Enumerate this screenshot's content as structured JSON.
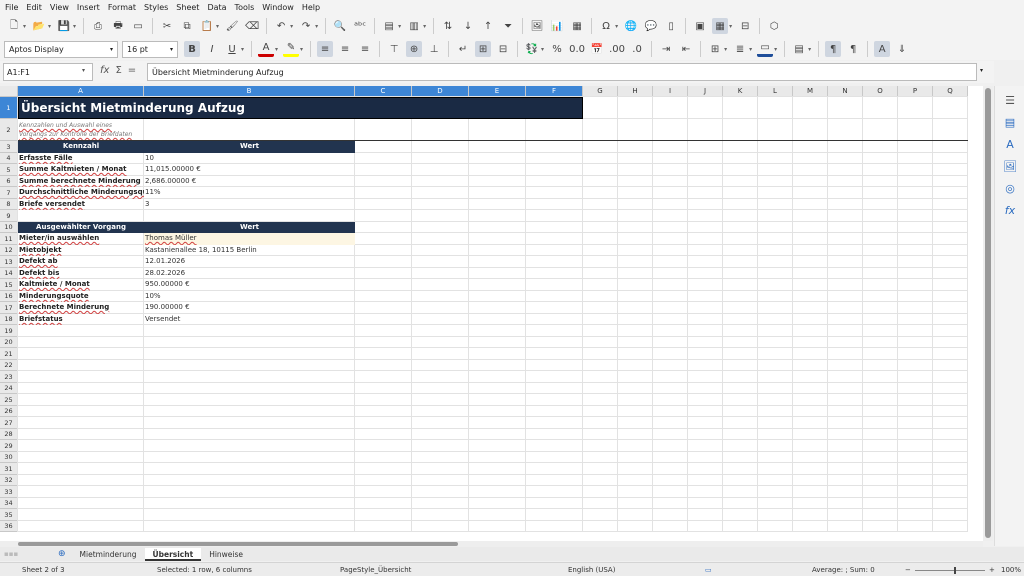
{
  "menu": [
    "File",
    "Edit",
    "View",
    "Insert",
    "Format",
    "Styles",
    "Sheet",
    "Data",
    "Tools",
    "Window",
    "Help"
  ],
  "format": {
    "font_name": "Aptos Display",
    "font_size": "16 pt"
  },
  "formula": {
    "name_box": "A1:F1",
    "content": "Übersicht Mietminderung Aufzug"
  },
  "columns": [
    "A",
    "B",
    "C",
    "D",
    "E",
    "F",
    "G",
    "H",
    "I",
    "J",
    "K",
    "L",
    "M",
    "N",
    "O",
    "P",
    "Q"
  ],
  "rows": [
    "1",
    "2",
    "3",
    "4",
    "5",
    "6",
    "7",
    "8",
    "9",
    "10",
    "11",
    "12",
    "13",
    "14",
    "15",
    "16",
    "17",
    "18",
    "19",
    "20",
    "21",
    "22",
    "23",
    "24",
    "25",
    "26",
    "27",
    "28",
    "29",
    "30",
    "31",
    "32",
    "33",
    "34",
    "35",
    "36"
  ],
  "sheet": {
    "title": "Übersicht Mietminderung Aufzug",
    "subtitle_line1": "Kennzahlen und Auswahl eines",
    "subtitle_line2": "Vorgangs zur Kontrolle der Briefdaten",
    "kpi_header": [
      "Kennzahl",
      "Wert"
    ],
    "kpis": [
      {
        "label": "Erfasste Fälle",
        "value": "10"
      },
      {
        "label": "Summe Kaltmieten / Monat",
        "value": "11,015.00000 €"
      },
      {
        "label": "Summe berechnete Minderung",
        "value": "2,686.00000 €"
      },
      {
        "label": "Durchschnittliche Minderungsquo",
        "value": "11%"
      },
      {
        "label": "Briefe versendet",
        "value": "3"
      }
    ],
    "case_header": [
      "Ausgewählter Vorgang",
      "Wert"
    ],
    "case": [
      {
        "label": "Mieter/in auswählen",
        "value": "Thomas Müller"
      },
      {
        "label": "Mietobjekt",
        "value": "Kastanienallee 18, 10115 Berlin"
      },
      {
        "label": "Defekt ab",
        "value": "12.01.2026"
      },
      {
        "label": "Defekt bis",
        "value": "28.02.2026"
      },
      {
        "label": "Kaltmiete / Monat",
        "value": "950.00000 €"
      },
      {
        "label": "Minderungsquote",
        "value": "10%"
      },
      {
        "label": "Berechnete Minderung",
        "value": "190.00000 €"
      },
      {
        "label": "Briefstatus",
        "value": "Versendet"
      }
    ]
  },
  "tabs": [
    "Mietminderung",
    "Übersicht",
    "Hinweise"
  ],
  "active_tab": "Übersicht",
  "status": {
    "sheet": "Sheet 2 of 3",
    "selection": "Selected: 1 row, 6 columns",
    "page_style": "PageStyle_Übersicht",
    "language": "English (USA)",
    "summary": "Average: ; Sum: 0",
    "zoom": "100%"
  },
  "colors": {
    "header_bg": "#22344f",
    "title_bg": "#1a2a44",
    "selection": "#3d86d6"
  }
}
